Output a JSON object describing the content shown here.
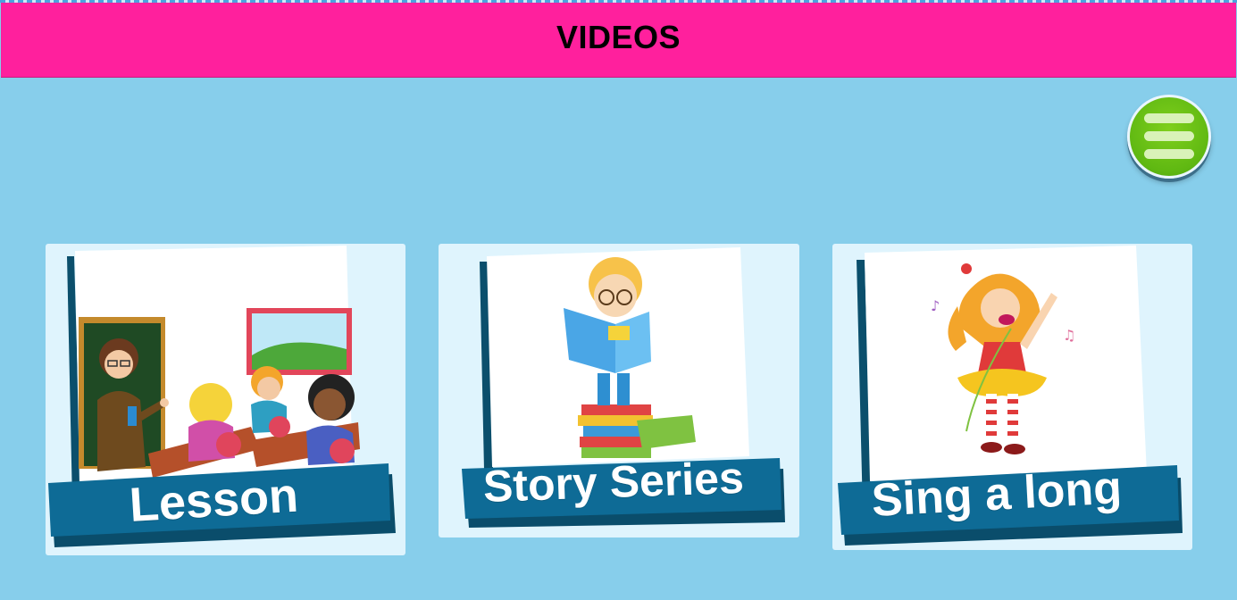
{
  "header": {
    "title": "VIDEOS"
  },
  "menu": {
    "icon": "hamburger-menu-icon"
  },
  "cards": [
    {
      "label": "Lesson",
      "illustration": "teacher-classroom"
    },
    {
      "label": "Story Series",
      "illustration": "boy-reading-books"
    },
    {
      "label": "Sing a long",
      "illustration": "girl-singing"
    }
  ],
  "colors": {
    "background": "#87ceeb",
    "header": "#ff209d",
    "banner": "#0e6b96",
    "menu_button": "#63bb12"
  }
}
